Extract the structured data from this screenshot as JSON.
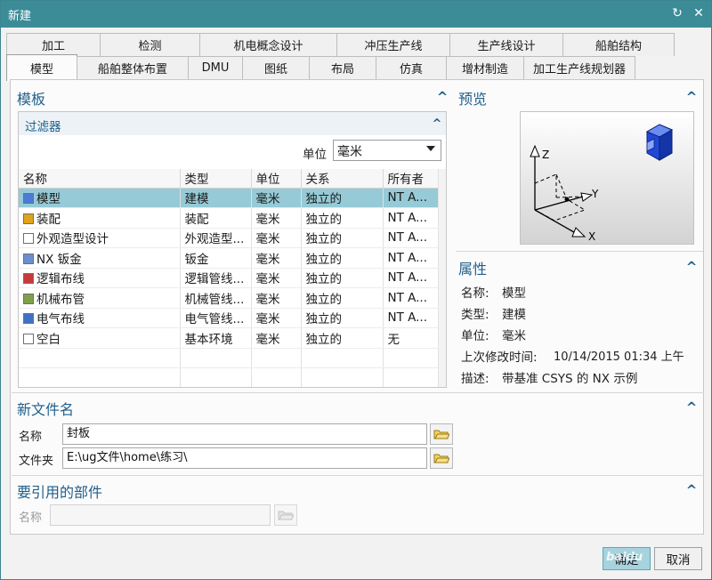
{
  "window": {
    "title": "新建"
  },
  "tabs_row1": [
    "加工",
    "检测",
    "机电概念设计",
    "冲压生产线",
    "生产线设计",
    "船舶结构"
  ],
  "tabs_row2": [
    "模型",
    "船舶整体布置",
    "DMU",
    "图纸",
    "布局",
    "仿真",
    "增材制造",
    "加工生产线规划器"
  ],
  "active_tab": "模型",
  "template": {
    "title": "模板",
    "filter_title": "过滤器",
    "unit_label": "单位",
    "unit_value": "毫米",
    "columns": [
      "名称",
      "类型",
      "单位",
      "关系",
      "所有者"
    ],
    "rows": [
      {
        "name": "模型",
        "type": "建模",
        "unit": "毫米",
        "relation": "独立的",
        "owner": "NT A...",
        "icon": "model-icon"
      },
      {
        "name": "装配",
        "type": "装配",
        "unit": "毫米",
        "relation": "独立的",
        "owner": "NT A...",
        "icon": "assembly-icon"
      },
      {
        "name": "外观造型设计",
        "type": "外观造型...",
        "unit": "毫米",
        "relation": "独立的",
        "owner": "NT A...",
        "icon": "shape-design-icon"
      },
      {
        "name": "NX 钣金",
        "type": "钣金",
        "unit": "毫米",
        "relation": "独立的",
        "owner": "NT A...",
        "icon": "sheet-metal-icon"
      },
      {
        "name": "逻辑布线",
        "type": "逻辑管线...",
        "unit": "毫米",
        "relation": "独立的",
        "owner": "NT A...",
        "icon": "logical-routing-icon"
      },
      {
        "name": "机械布管",
        "type": "机械管线...",
        "unit": "毫米",
        "relation": "独立的",
        "owner": "NT A...",
        "icon": "mechanical-piping-icon"
      },
      {
        "name": "电气布线",
        "type": "电气管线...",
        "unit": "毫米",
        "relation": "独立的",
        "owner": "NT A...",
        "icon": "electrical-routing-icon"
      },
      {
        "name": "空白",
        "type": "基本环境",
        "unit": "毫米",
        "relation": "独立的",
        "owner": "无",
        "icon": "blank-file-icon"
      }
    ],
    "selected_index": 0
  },
  "preview": {
    "title": "预览",
    "axis_z": "Z",
    "axis_y": "Y",
    "axis_x": "X"
  },
  "properties": {
    "title": "属性",
    "name_label": "名称:",
    "name_value": "模型",
    "type_label": "类型:",
    "type_value": "建模",
    "unit_label": "单位:",
    "unit_value": "毫米",
    "modified_label": "上次修改时间:",
    "modified_value": "10/14/2015 01:34 上午",
    "desc_label": "描述:",
    "desc_value": "带基准 CSYS 的 NX 示例"
  },
  "new_file": {
    "title": "新文件名",
    "name_label": "名称",
    "name_value": "封板",
    "folder_label": "文件夹",
    "folder_value": "E:\\ug文件\\home\\练习\\"
  },
  "reference_part": {
    "title": "要引用的部件",
    "name_label": "名称",
    "name_value": ""
  },
  "buttons": {
    "ok": "确定",
    "cancel": "取消"
  },
  "watermark": "baidu",
  "colors": {
    "titlebar": "#3c8c98",
    "selection": "#96cad6",
    "section_title": "#1f5f8b",
    "primary_button": "#a7d3df"
  }
}
